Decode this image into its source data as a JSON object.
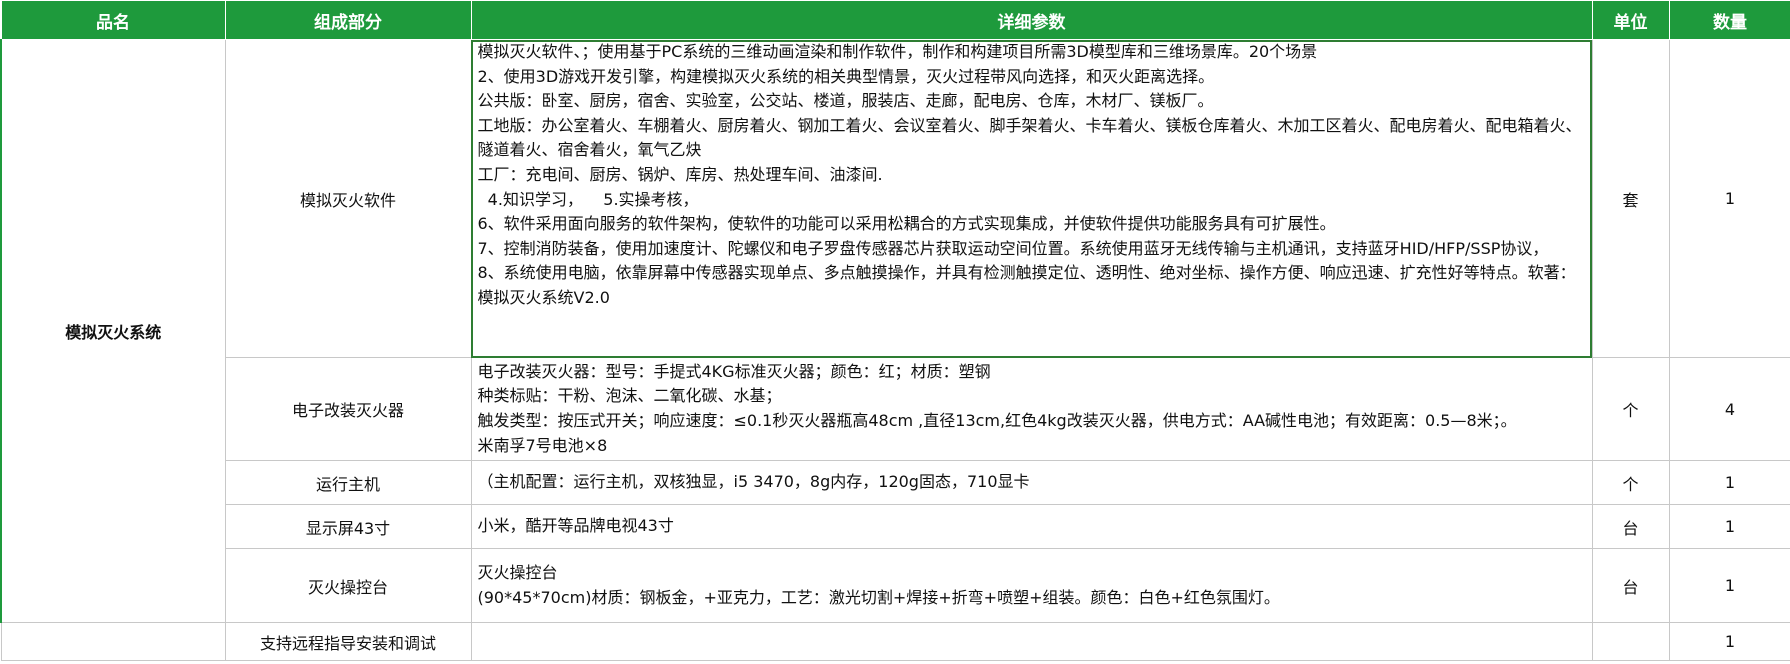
{
  "headers": [
    "品名",
    "组成部分",
    "详细参数",
    "单位",
    "数量"
  ],
  "product": "模拟灭火系统",
  "rows": [
    {
      "component": "模拟灭火软件",
      "details": [
        "模拟灭火软件、；使用基于PC系统的三维动画渲染和制作软件，制作和构建项目所需3D模型库和三维场景库。20个场景",
        "2、使用3D游戏开发引擎，构建模拟灭火系统的相关典型情景，灭火过程带风向选择，和灭火距离选择。",
        "公共版：卧室、厨房，宿舍、实验室，公交站、楼道，服装店、走廊，配电房、仓库，木材厂、镁板厂。",
        "工地版：办公室着火、车棚着火、厨房着火、钢加工着火、会议室着火、脚手架着火、卡车着火、镁板仓库着火、木加工区着火、配电房着火、配电箱着火、隧道着火、宿舍着火，氧气乙炔",
        "工厂：充电间、厨房、锅炉、库房、热处理车间、油漆间.",
        "  4.知识学习，    5.实操考核，",
        "6、软件采用面向服务的软件架构，使软件的功能可以采用松耦合的方式实现集成，并使软件提供功能服务具有可扩展性。",
        "7、控制消防装备，使用加速度计、陀螺仪和电子罗盘传感器芯片获取运动空间位置。系统使用蓝牙无线传输与主机通讯，支持蓝牙HID/HFP/SSP协议，",
        "8、系统使用电脑，依靠屏幕中传感器实现单点、多点触摸操作，并具有检测触摸定位、透明性、绝对坐标、操作方便、响应迅速、扩充性好等特点。软著：模拟灭火系统V2.0"
      ],
      "unit": "套",
      "qty": "1"
    },
    {
      "component": "电子改装灭火器",
      "details": [
        "电子改装灭火器：型号：手提式4KG标准灭火器；颜色：红；材质：塑钢",
        "种类标贴：干粉、泡沫、二氧化碳、水基；",
        "触发类型：按压式开关；响应速度：≤0.1秒灭火器瓶高48cm ,直径13cm,红色4kg改装灭火器，供电方式：AA碱性电池；有效距离：0.5—8米；。",
        "米南孚7号电池×8"
      ],
      "unit": "个",
      "qty": "4"
    },
    {
      "component": "运行主机",
      "details": [
        "（主机配置：运行主机，双核独显，i5 3470，8g内存，120g固态，710显卡"
      ],
      "unit": "个",
      "qty": "1"
    },
    {
      "component": "显示屏43寸",
      "details": [
        "小米，酷开等品牌电视43寸"
      ],
      "unit": "台",
      "qty": "1"
    },
    {
      "component": "灭火操控台",
      "details": [
        "灭火操控台",
        "(90*45*70cm)材质：钢板金，+亚克力，工艺：激光切割+焊接+折弯+喷塑+组装。颜色：白色+红色氛围灯。"
      ],
      "unit": "台",
      "qty": "1"
    },
    {
      "component": "支持远程指导安装和调试",
      "details": [
        ""
      ],
      "unit": "",
      "qty": "1"
    }
  ]
}
